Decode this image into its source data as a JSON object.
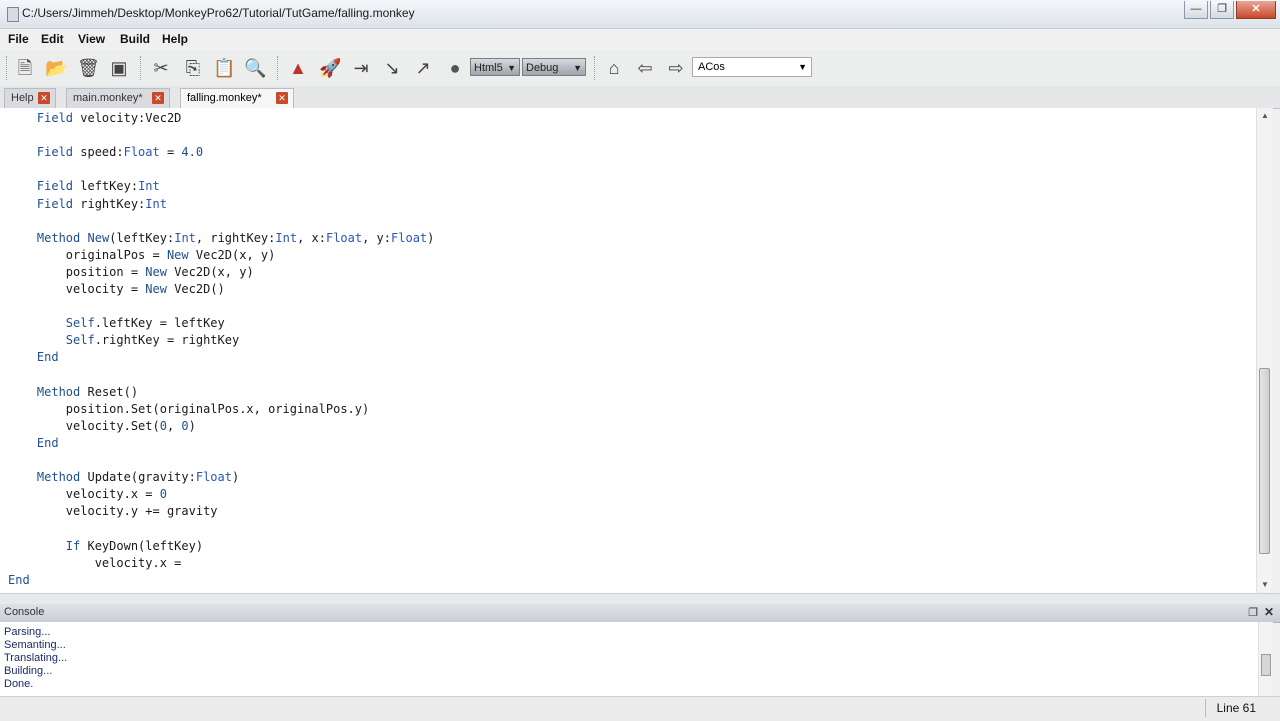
{
  "window": {
    "title": "C:/Users/Jimmeh/Desktop/MonkeyPro62/Tutorial/TutGame/falling.monkey",
    "minimize": "—",
    "restore": "❐",
    "close": "✕"
  },
  "menu": {
    "file": "File",
    "edit": "Edit",
    "view": "View",
    "build": "Build",
    "help": "Help"
  },
  "toolbar": {
    "target_select": "Html5",
    "config_select": "Debug",
    "symbol_select": "ACos"
  },
  "tabs": [
    {
      "label": "Help"
    },
    {
      "label": "main.monkey*"
    },
    {
      "label": "falling.monkey*"
    }
  ],
  "code_lines": [
    "    Field velocity:Vec2D",
    "",
    "    Field speed:Float = 4.0",
    "",
    "    Field leftKey:Int",
    "    Field rightKey:Int",
    "",
    "    Method New(leftKey:Int, rightKey:Int, x:Float, y:Float)",
    "        originalPos = New Vec2D(x, y)",
    "        position = New Vec2D(x, y)",
    "        velocity = New Vec2D()",
    "",
    "        Self.leftKey = leftKey",
    "        Self.rightKey = rightKey",
    "    End",
    "",
    "    Method Reset()",
    "        position.Set(originalPos.x, originalPos.y)",
    "        velocity.Set(0, 0)",
    "    End",
    "",
    "    Method Update(gravity:Float)",
    "        velocity.x = 0",
    "        velocity.y += gravity",
    "",
    "        If KeyDown(leftKey)",
    "            velocity.x = ",
    "End"
  ],
  "console": {
    "title": "Console",
    "restore": "❐",
    "close": "✕",
    "lines": [
      "Parsing...",
      "Semanting...",
      "Translating...",
      "Building...",
      "Done."
    ]
  },
  "status": {
    "line": "Line 61"
  },
  "colors": {
    "keyword": "#1f4f8f",
    "type": "#2a55b5",
    "console_text": "#1a2a66",
    "tab_close": "#c84a2c"
  }
}
